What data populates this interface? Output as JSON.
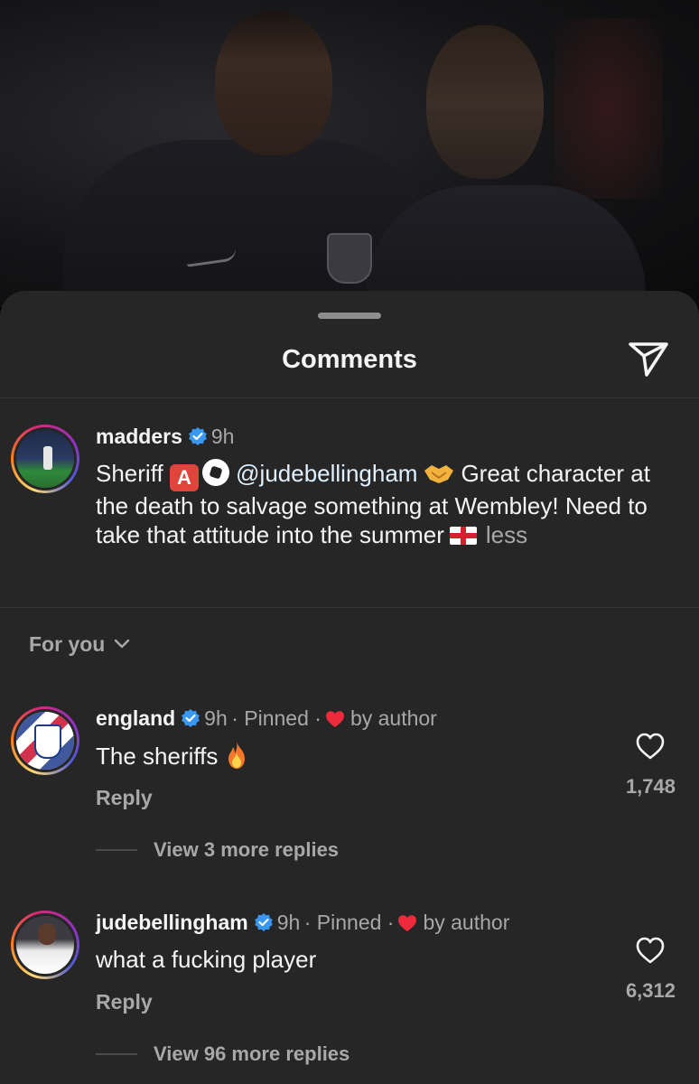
{
  "sheet": {
    "title": "Comments"
  },
  "caption": {
    "username": "madders",
    "time": "9h",
    "text_part1": "Sheriff",
    "emoji_a": "A",
    "mention": "@judebellingham",
    "text_part2": "Great character at the death to salvage something at Wembley! Need to take that attitude into the summer",
    "less_label": "less"
  },
  "filter": {
    "label": "For you"
  },
  "comments": [
    {
      "username": "england",
      "time": "9h",
      "pinned": "· Pinned ·",
      "by_author": "by author",
      "text": "The sheriffs",
      "reply_label": "Reply",
      "likes": "1,748",
      "view_replies": "View 3 more replies"
    },
    {
      "username": "judebellingham",
      "time": "9h",
      "pinned": "· Pinned ·",
      "by_author": "by author",
      "text": "what a fucking player",
      "reply_label": "Reply",
      "likes": "6,312",
      "view_replies": "View 96 more replies"
    }
  ],
  "colors": {
    "sheet_bg": "#262626",
    "text_primary": "#f5f5f5",
    "text_secondary": "#a8a8a8",
    "verified_blue": "#3897f0",
    "heart_red": "#ed2b3a"
  }
}
